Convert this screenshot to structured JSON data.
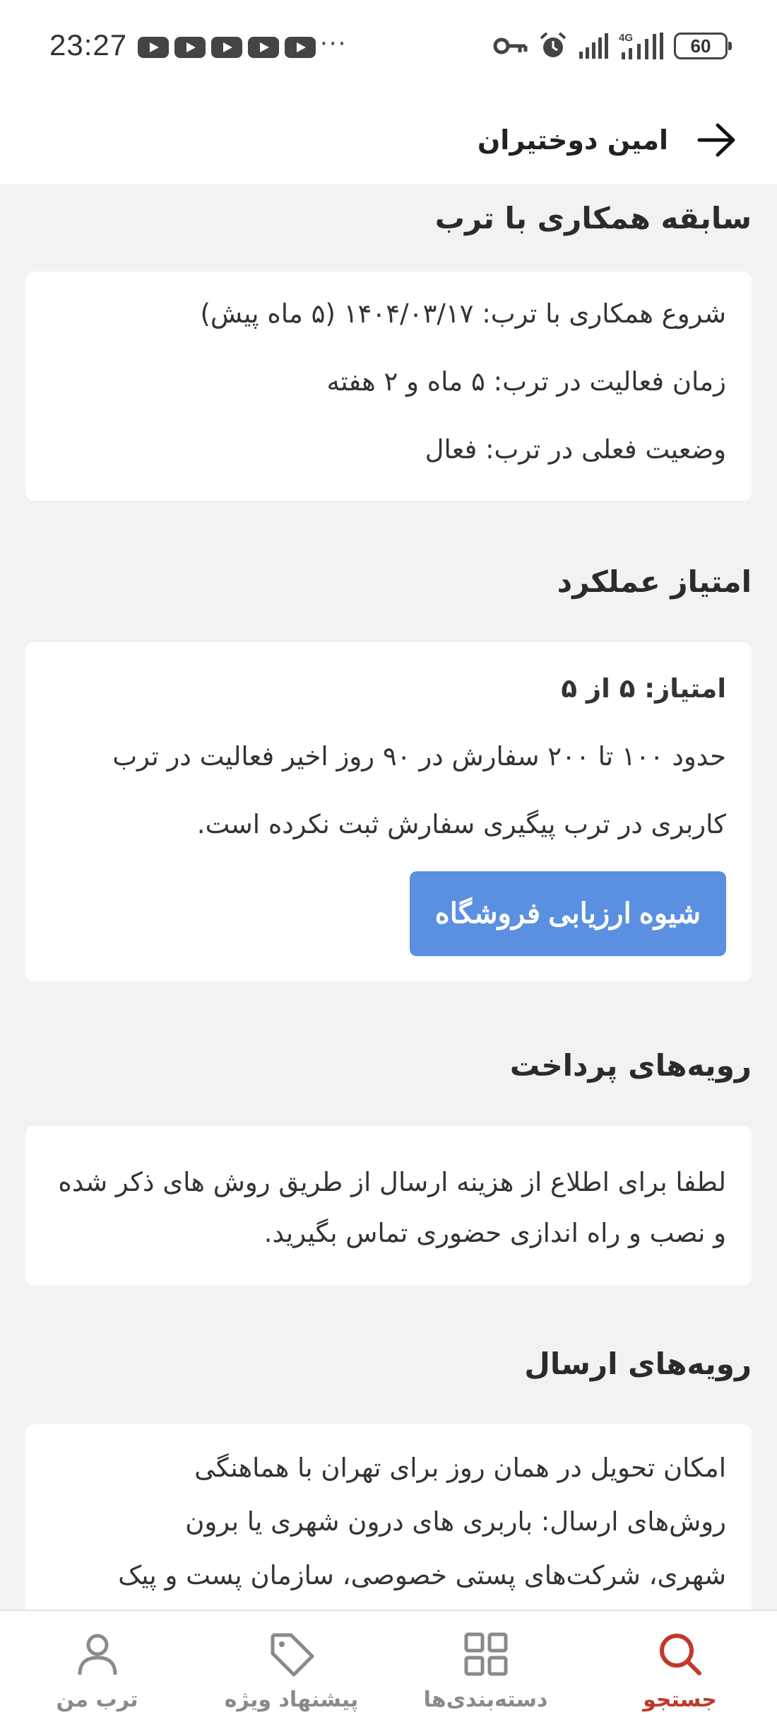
{
  "status_bar": {
    "time": "23:27",
    "more": "···",
    "battery": "60",
    "icons": [
      "youtube-icon",
      "key-icon",
      "alarm-icon",
      "signal-icon",
      "4g-signal-icon",
      "battery-icon"
    ]
  },
  "header": {
    "title": "امین دوختیران",
    "back_icon": "arrow-right-icon"
  },
  "history": {
    "title": "سابقه همکاری با ترب",
    "lines": [
      "شروع همکاری با ترب: ۱۴۰۴/۰۳/۱۷ (۵ ماه پیش)",
      "زمان فعالیت در ترب: ۵ ماه و ۲ هفته",
      "وضعیت فعلی در ترب: فعال"
    ]
  },
  "performance": {
    "title": "امتیاز عملکرد",
    "score": "امتیاز: ۵ از ۵",
    "orders": "حدود ۱۰۰ تا ۲۰۰ سفارش در ۹۰ روز اخیر فعالیت در ترب",
    "tracking": "کاربری در ترب پیگیری سفارش ثبت نکرده است.",
    "button_label": "شیوه ارزیابی فروشگاه"
  },
  "payment": {
    "title": "رویه‌های پرداخت",
    "text": "لطفا برای اطلاع از هزینه ارسال از طریق روش های ذکر شده و نصب و راه اندازی حضوری تماس بگیرید."
  },
  "shipping": {
    "title": "رویه‌های ارسال",
    "line1": "امکان تحویل در همان روز برای تهران با هماهنگی",
    "line2": "روش‌های ارسال: باربری های درون شهری یا برون",
    "line3": "شهری، شرکت‌های پستی خصوصی، سازمان پست و پیک"
  },
  "bottom_nav": {
    "items": [
      {
        "label": "جستجو",
        "icon": "search-icon",
        "active": true
      },
      {
        "label": "دسته‌بندی‌ها",
        "icon": "grid-icon",
        "active": false
      },
      {
        "label": "پیشنهاد ویژه",
        "icon": "tag-icon",
        "active": false
      },
      {
        "label": "ترب من",
        "icon": "user-icon",
        "active": false
      }
    ]
  },
  "colors": {
    "accent_active": "#c0392b",
    "button": "#5b8fe0",
    "background": "#f1f2f4"
  }
}
